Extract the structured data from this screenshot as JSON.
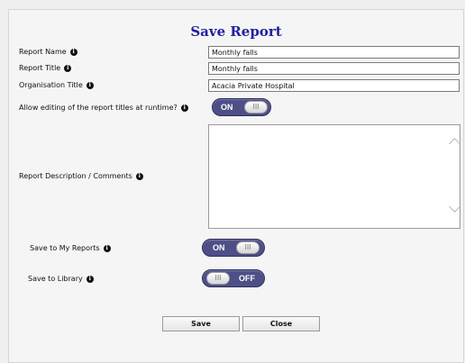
{
  "dialog": {
    "title": "Save Report"
  },
  "fields": {
    "report_name": {
      "label": "Report Name",
      "value": "Monthly falls"
    },
    "report_title": {
      "label": "Report Title",
      "value": "Monthly falls"
    },
    "organisation_title": {
      "label": "Organisation Title",
      "value": "Acacia Private Hospital"
    },
    "allow_editing": {
      "label": "Allow editing of the report titles at runtime?",
      "state": "ON",
      "knob": "III"
    },
    "description": {
      "label": "Report Description / Comments",
      "value": ""
    },
    "save_my_reports": {
      "label": "Save to My Reports",
      "state": "ON",
      "knob": "III"
    },
    "save_library": {
      "label": "Save to Library",
      "state": "OFF",
      "knob": "III"
    }
  },
  "info_glyph": "i",
  "icons": {
    "info": "info-icon",
    "scroll_up": "chevron-up-icon",
    "scroll_down": "chevron-down-icon"
  },
  "colors": {
    "title": "#22209e",
    "toggle": "#4e4f86"
  },
  "buttons": {
    "save": "Save",
    "close": "Close"
  }
}
